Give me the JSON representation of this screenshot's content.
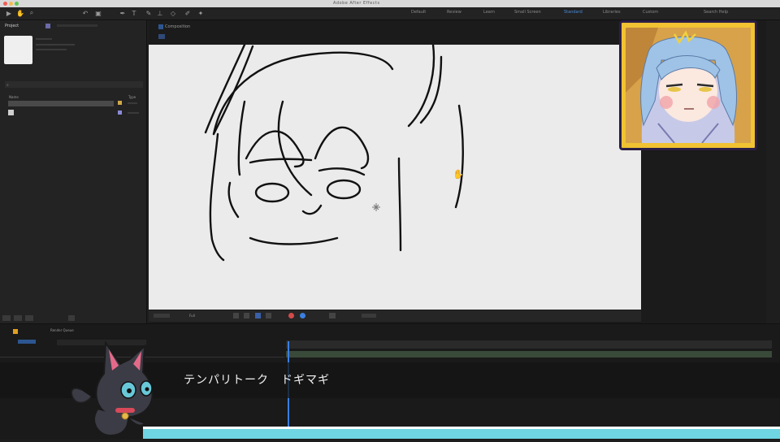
{
  "window": {
    "title": "Adobe After Effects"
  },
  "toolbar": {
    "workspaces": [
      "Default",
      "Review",
      "Learn",
      "Small Screen",
      "Standard",
      "Libraries",
      "Custom"
    ],
    "active_workspace": "Standard",
    "search_placeholder": "Search Help"
  },
  "project": {
    "tab": "Project",
    "columns": [
      "Name",
      "Type"
    ]
  },
  "composition": {
    "tab": "Composition",
    "viewer": {
      "resolution": "Full"
    }
  },
  "timeline": {
    "tab": "Render Queue"
  },
  "subtitle": {
    "text": "テンパリトーク　ドギマギ"
  },
  "colors": {
    "accent": "#3b7fe0",
    "bottom_line": "#6fd5e3",
    "avatar_border": "#f1c232",
    "avatar_bg": "#7c4fb0"
  }
}
